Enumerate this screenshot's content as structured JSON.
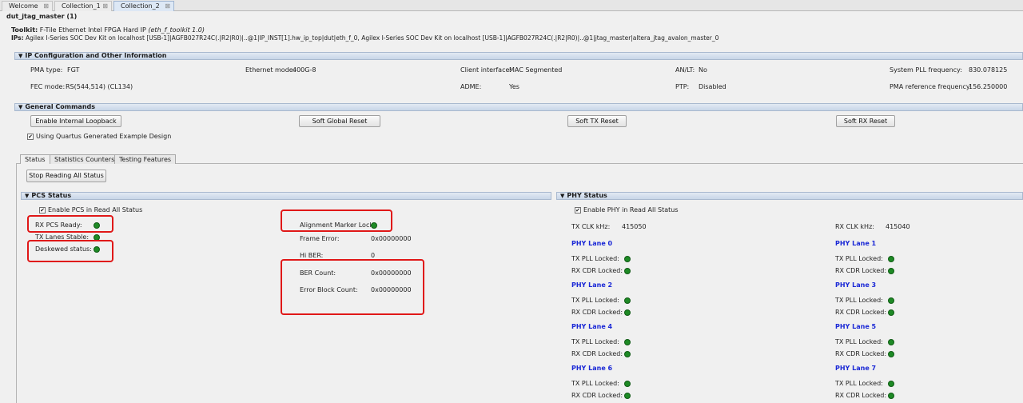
{
  "tabs": [
    {
      "label": "Welcome"
    },
    {
      "label": "Collection_1"
    },
    {
      "label": "Collection_2"
    }
  ],
  "close_glyph": "⊠",
  "header": {
    "title": "dut_jtag_master (1)",
    "toolkit_label": "Toolkit:",
    "toolkit_value": "F-Tile Ethernet Intel FPGA Hard IP",
    "toolkit_italic": "(eth_f_toolkit 1.0)",
    "ips_label": "IPs:",
    "ips_value": "Agilex I-Series SOC Dev Kit on localhost [USB-1]|AGFB027R24C(.|R2|R0)|..@1|IP_INST[1].hw_ip_top|dut|eth_f_0, Agilex I-Series SOC Dev Kit on localhost [USB-1]|AGFB027R24C(.|R2|R0)|..@1|jtag_master|altera_jtag_avalon_master_0"
  },
  "ipconfig": {
    "title": "IP Configuration and Other Information",
    "pma_type_label": "PMA type:",
    "pma_type_value": "FGT",
    "eth_mode_label": "Ethernet mode:",
    "eth_mode_value": "400G-8",
    "client_if_label": "Client interface:",
    "client_if_value": "MAC Segmented",
    "anlt_label": "AN/LT:",
    "anlt_value": "No",
    "syspll_label": "System PLL frequency:",
    "syspll_value": "830.078125",
    "fec_label": "FEC mode:",
    "fec_value": "RS(544,514) (CL134)",
    "adme_label": "ADME:",
    "adme_value": "Yes",
    "ptp_label": "PTP:",
    "ptp_value": "Disabled",
    "pmaref_label": "PMA reference frequency:",
    "pmaref_value": "156.250000"
  },
  "general": {
    "title": "General Commands",
    "btn_loopback": "Enable Internal Loopback",
    "btn_global_reset": "Soft Global Reset",
    "btn_tx_reset": "Soft TX Reset",
    "btn_rx_reset": "Soft RX Reset",
    "quartus_check_label": "Using Quartus Generated Example Design"
  },
  "subtabs": [
    {
      "label": "Status"
    },
    {
      "label": "Statistics Counters"
    },
    {
      "label": "Testing Features"
    }
  ],
  "status": {
    "stop_button": "Stop Reading All Status"
  },
  "pcs": {
    "title": "PCS Status",
    "enable_label": "Enable PCS in Read All Status",
    "rx_ready_label": "RX PCS Ready:",
    "tx_stable_label": "TX Lanes Stable:",
    "deskewed_label": "Deskewed status:",
    "align_label": "Alignment Marker Lock:",
    "frame_error_label": "Frame Error:",
    "frame_error_value": "0x00000000",
    "hiber_label": "Hi BER:",
    "hiber_value": "0",
    "ber_label": "BER Count:",
    "ber_value": "0x00000000",
    "errblock_label": "Error Block Count:",
    "errblock_value": "0x00000000"
  },
  "phy": {
    "title": "PHY Status",
    "enable_label": "Enable PHY in Read All Status",
    "tx_clk_label": "TX CLK kHz:",
    "tx_clk_value": "415050",
    "rx_clk_label": "RX CLK kHz:",
    "rx_clk_value": "415040",
    "tx_pll_label": "TX PLL Locked:",
    "rx_cdr_label": "RX CDR Locked:",
    "lanes": [
      {
        "label": "PHY Lane 0"
      },
      {
        "label": "PHY Lane 1"
      },
      {
        "label": "PHY Lane 2"
      },
      {
        "label": "PHY Lane 3"
      },
      {
        "label": "PHY Lane 4"
      },
      {
        "label": "PHY Lane 5"
      },
      {
        "label": "PHY Lane 6"
      },
      {
        "label": "PHY Lane 7"
      }
    ]
  },
  "colors": {
    "status_ok": "#1e8a25",
    "lane_title": "#1a28d6",
    "highlight": "#e01818"
  },
  "icons": {
    "section_chevron": "▼",
    "check": "✔"
  }
}
